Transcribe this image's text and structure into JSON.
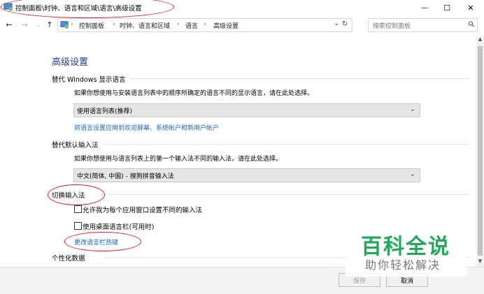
{
  "window": {
    "title": "控制面板\\时钟、语言和区域\\语言\\高级设置",
    "minimize": "—",
    "maximize": "☐",
    "close": "✕"
  },
  "nav": {
    "back": "←",
    "forward": "→",
    "up": "↑",
    "breadcrumbs": [
      "控制面板",
      "时钟、语言和区域",
      "语言",
      "高级设置"
    ],
    "crumb_sep": "›",
    "refresh": "↻",
    "dropdown": "⌄",
    "search_placeholder": "搜索控制面板",
    "search_glyph": "⚲"
  },
  "main": {
    "heading": "高级设置",
    "display_language": {
      "title": "替代 Windows 显示语言",
      "description": "如果你想使用与安装语言列表中的顺序所确定的语言不同的显示语言，请在此处选择。",
      "selected": "使用语言列表(推荐)",
      "link": "将语言设置应用到欢迎屏幕、系统帐户和新用户帐户"
    },
    "default_input": {
      "title": "替代默认输入法",
      "description": "如果你想使用与语言列表上的第一个输入法不同的输入法，请在此处选择。",
      "selected": "中文(简体, 中国) - 搜狗拼音输入法"
    },
    "switch_input": {
      "title": "切换输入法",
      "option1": "允许我为每个应用窗口设置不同的输入法",
      "option2": "使用桌面语言栏(可用时)",
      "link": "更改语言栏热键"
    },
    "personalization": {
      "title": "个性化数据"
    }
  },
  "footer": {
    "save": "保存",
    "cancel": "取消"
  },
  "watermark": {
    "big": "百科全说",
    "small": "助你轻松解决"
  },
  "colors": {
    "heading": "#1e3c8c",
    "link": "#1a66c4",
    "annotation": "#d4202b",
    "watermark": "#22a957"
  }
}
